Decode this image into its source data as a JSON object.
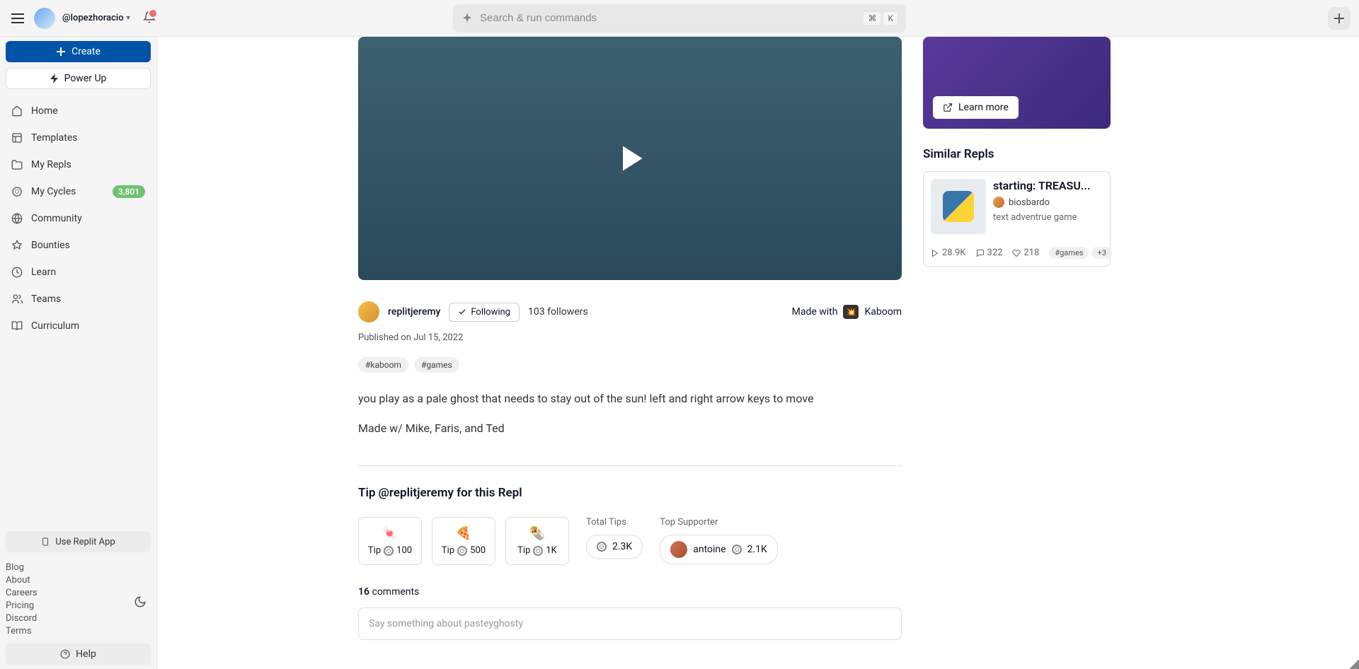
{
  "header": {
    "username": "@lopezhoracio",
    "search_placeholder": "Search & run commands",
    "kbd_cmd": "⌘",
    "kbd_k": "K"
  },
  "sidebar": {
    "create_label": "Create",
    "powerup_label": "Power Up",
    "nav": [
      {
        "label": "Home"
      },
      {
        "label": "Templates"
      },
      {
        "label": "My Repls"
      },
      {
        "label": "My Cycles",
        "badge": "3,801"
      },
      {
        "label": "Community"
      },
      {
        "label": "Bounties"
      },
      {
        "label": "Learn"
      },
      {
        "label": "Teams"
      },
      {
        "label": "Curriculum"
      }
    ],
    "use_app_label": "Use Replit App",
    "footer_links": [
      "Blog",
      "About",
      "Careers",
      "Pricing",
      "Discord",
      "Terms"
    ],
    "help_label": "Help"
  },
  "repl": {
    "author": "replitjeremy",
    "following_label": "Following",
    "followers": "103 followers",
    "made_with_label": "Made with",
    "made_with_tool": "Kaboom",
    "published": "Published on Jul 15, 2022",
    "tags": [
      "#kaboom",
      "#games"
    ],
    "desc_line1": "you play as a pale ghost that needs to stay out of the sun! left and right arrow keys to move",
    "desc_line2": "Made w/ Mike, Faris, and Ted"
  },
  "tips": {
    "heading": "Tip @replitjeremy for this Repl",
    "options": [
      {
        "emoji": "🍬",
        "label": "Tip",
        "amount": "100"
      },
      {
        "emoji": "🍕",
        "label": "Tip",
        "amount": "500"
      },
      {
        "emoji": "🌯",
        "label": "Tip",
        "amount": "1K"
      }
    ],
    "total_label": "Total Tips",
    "total_value": "2.3K",
    "top_label": "Top Supporter",
    "top_name": "antoine",
    "top_amount": "2.1K"
  },
  "comments": {
    "count": "16",
    "label": "comments",
    "placeholder": "Say something about pasteyghosty"
  },
  "promo": {
    "learn_more_label": "Learn more"
  },
  "similar": {
    "heading": "Similar Repls",
    "item": {
      "title": "starting: TREASU...",
      "author": "biosbardo",
      "desc": "text adventrue game",
      "plays": "28.9K",
      "comments": "322",
      "likes": "218",
      "tag": "#games",
      "more_tags": "+3"
    }
  }
}
